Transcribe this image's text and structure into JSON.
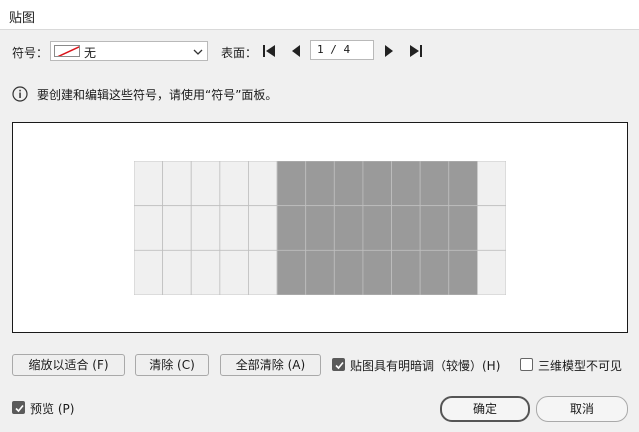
{
  "window": {
    "title": "贴图"
  },
  "symbol": {
    "label": "符号：",
    "value": "无"
  },
  "surface": {
    "label": "表面：",
    "page_text": "1 / 4"
  },
  "info": {
    "text": "要创建和编辑这些符号，请使用“符号”面板。"
  },
  "preview_grid": {
    "columns": 13,
    "rows": 3,
    "shaded_start_col": 5,
    "shaded_end_col": 11,
    "light_color": "#f0f0f0",
    "shade_color": "#9a9a9a",
    "line_color": "#bfbfbf"
  },
  "buttons": {
    "scale_to_fit": "缩放以适合 (F)",
    "clear": "清除 (C)",
    "clear_all": "全部清除 (A)",
    "ok": "确定",
    "cancel": "取消"
  },
  "options": {
    "shade_artwork": {
      "label": "贴图具有明暗调（较慢）(H)",
      "checked": true
    },
    "invisible_geometry": {
      "label": "三维模型不可见",
      "checked": false
    },
    "preview": {
      "label": "预览 (P)",
      "checked": true
    }
  }
}
